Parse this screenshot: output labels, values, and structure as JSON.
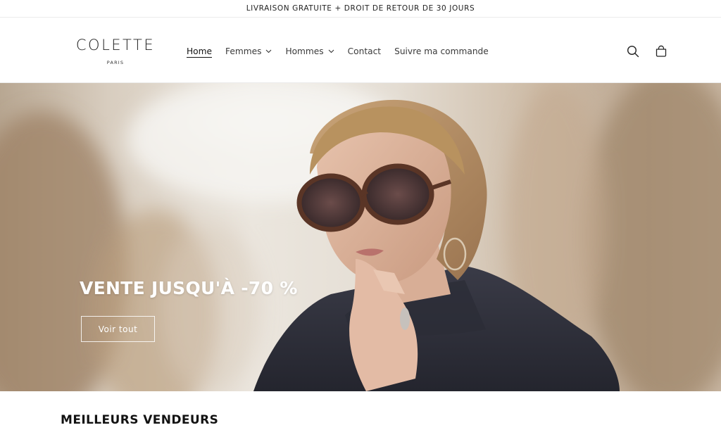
{
  "announcement": {
    "text": "LIVRAISON GRATUITE + DROIT DE RETOUR DE 30 JOURS"
  },
  "header": {
    "logo": {
      "brand": "COLETTE",
      "city": "PARIS"
    },
    "nav": [
      {
        "label": "Home",
        "active": true
      },
      {
        "label": "Femmes",
        "dropdown": true
      },
      {
        "label": "Hommes",
        "dropdown": true
      },
      {
        "label": "Contact"
      },
      {
        "label": "Suivre ma commande"
      }
    ],
    "icons": [
      "search-icon",
      "cart-icon"
    ]
  },
  "hero": {
    "title": "VENTE JUSQU'À -70 %",
    "button_label": "Voir tout"
  },
  "best_sellers": {
    "title": "MEILLEURS VENDEURS"
  }
}
